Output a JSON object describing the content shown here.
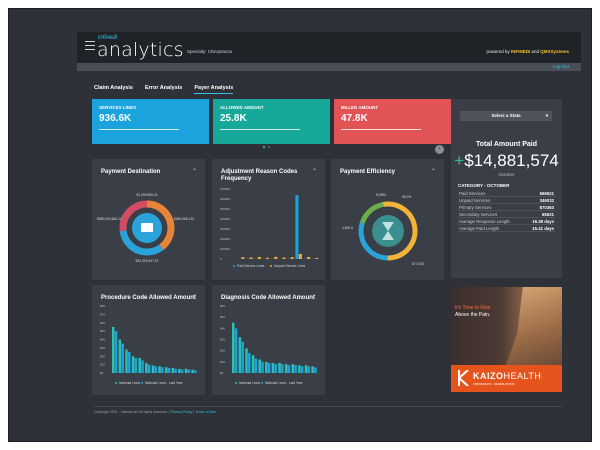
{
  "header": {
    "logo_small": "infinedi",
    "logo": "analytics",
    "specialty": "Specialty: Chiropractor",
    "powered_prefix": "powered by ",
    "powered_brand1": "INFINEDI",
    "powered_mid": " and ",
    "powered_brand2": "QMXSystems",
    "logout": "Log Out"
  },
  "tabs": [
    {
      "label": "Claim Analysis"
    },
    {
      "label": "Error Analysis"
    },
    {
      "label": "Payer Analysis"
    }
  ],
  "kpis": [
    {
      "label": "SERVICES LINES",
      "value": "936.6K",
      "color": "#1aa3dc"
    },
    {
      "label": "ALLOWED AMOUNT",
      "value": "25.8K",
      "color": "#16a899"
    },
    {
      "label": "BILLED AMOUNT",
      "value": "47.8K",
      "color": "#e25356"
    }
  ],
  "panels": {
    "payment_destination": {
      "title": "Payment Destination",
      "labels": [
        "$1,099,665.34",
        "$550,003,682.12",
        "$560,086,130",
        "$30,029,647.57"
      ]
    },
    "adjustment": {
      "title": "Adjustment Reason Codes Frequency",
      "legend": [
        "Paid Service Lines",
        "Unpaid Service Lines"
      ]
    },
    "efficiency": {
      "title": "Payment Efficiency",
      "labels": [
        "8,090k",
        "58.2%",
        "4,800.0",
        "877,030"
      ]
    },
    "procedure": {
      "title": "Procedure Code Allowed Amount",
      "legend": [
        "National Level",
        "National Level - Last Year"
      ]
    },
    "diagnosis": {
      "title": "Diagnosis Code Allowed Amount",
      "legend": [
        "National Level",
        "National Level - Last Year"
      ]
    }
  },
  "state_panel": {
    "select_label": "Select a State",
    "title": "Total Amount Paid",
    "plus": "+",
    "amount": "$14,881,574",
    "month": "October",
    "category_title": "CATEGORY - OCTOBER",
    "rows": [
      {
        "k": "Paid Services",
        "v": "569621"
      },
      {
        "k": "Unpaid Services",
        "v": "346032"
      },
      {
        "k": "Primary Services",
        "v": "870363"
      },
      {
        "k": "Secondary Services",
        "v": "65621"
      },
      {
        "k": "Average Response Length",
        "v": "16.38 days"
      },
      {
        "k": "Average Paid Length",
        "v": "15.41 days"
      }
    ]
  },
  "ad": {
    "line1": "It's Time to Rise",
    "line2": "Above the Pain.",
    "brand1": "KAIZO",
    "brand2": "HEALTH",
    "tagline": "CHIROPRACTIC · REHABILITATION"
  },
  "footer": {
    "text": "Copyright 2021 - Infinedi.net All rights reserved. | ",
    "privacy": "Privacy Policy",
    "sep": " | ",
    "terms": "Terms of Use"
  },
  "colors": {
    "accent": "#36c1e3",
    "bar_primary": "#1aa3dc",
    "bar_secondary": "#f2a73b",
    "bar_teal": "#2bc0b3"
  },
  "charts": {
    "adjustment": {
      "y_ticks": [
        "700000",
        "600000",
        "500000",
        "400000",
        "300000",
        "200000",
        "100000",
        "0"
      ],
      "ylim": [
        0,
        700000
      ],
      "paid": [
        2000,
        3000,
        1500,
        2500,
        3000,
        1000,
        2000,
        640000,
        3000,
        2000
      ],
      "unpaid": [
        18000,
        15000,
        20000,
        12000,
        22000,
        15000,
        18000,
        50000,
        20000,
        10000
      ]
    },
    "procedure": {
      "y_ticks": [
        "$80",
        "$70",
        "$60",
        "$50",
        "$40",
        "$30",
        "$20",
        "$10",
        "$0"
      ],
      "ylim": [
        0,
        80
      ],
      "series_a": [
        55,
        40,
        28,
        20,
        18,
        12,
        9,
        8,
        7,
        6,
        5,
        5,
        4
      ],
      "series_b": [
        50,
        35,
        25,
        18,
        15,
        10,
        8,
        7,
        6,
        5,
        4,
        4,
        3
      ]
    },
    "diagnosis": {
      "y_ticks": [
        "$60",
        "$50",
        "$40",
        "$30",
        "$20",
        "$10",
        "$0"
      ],
      "ylim": [
        0,
        60
      ],
      "series_a": [
        45,
        32,
        22,
        16,
        12,
        10,
        9,
        9,
        8,
        8,
        7,
        7,
        6
      ],
      "series_b": [
        40,
        28,
        18,
        13,
        10,
        9,
        8,
        8,
        7,
        7,
        6,
        6,
        5
      ]
    }
  }
}
